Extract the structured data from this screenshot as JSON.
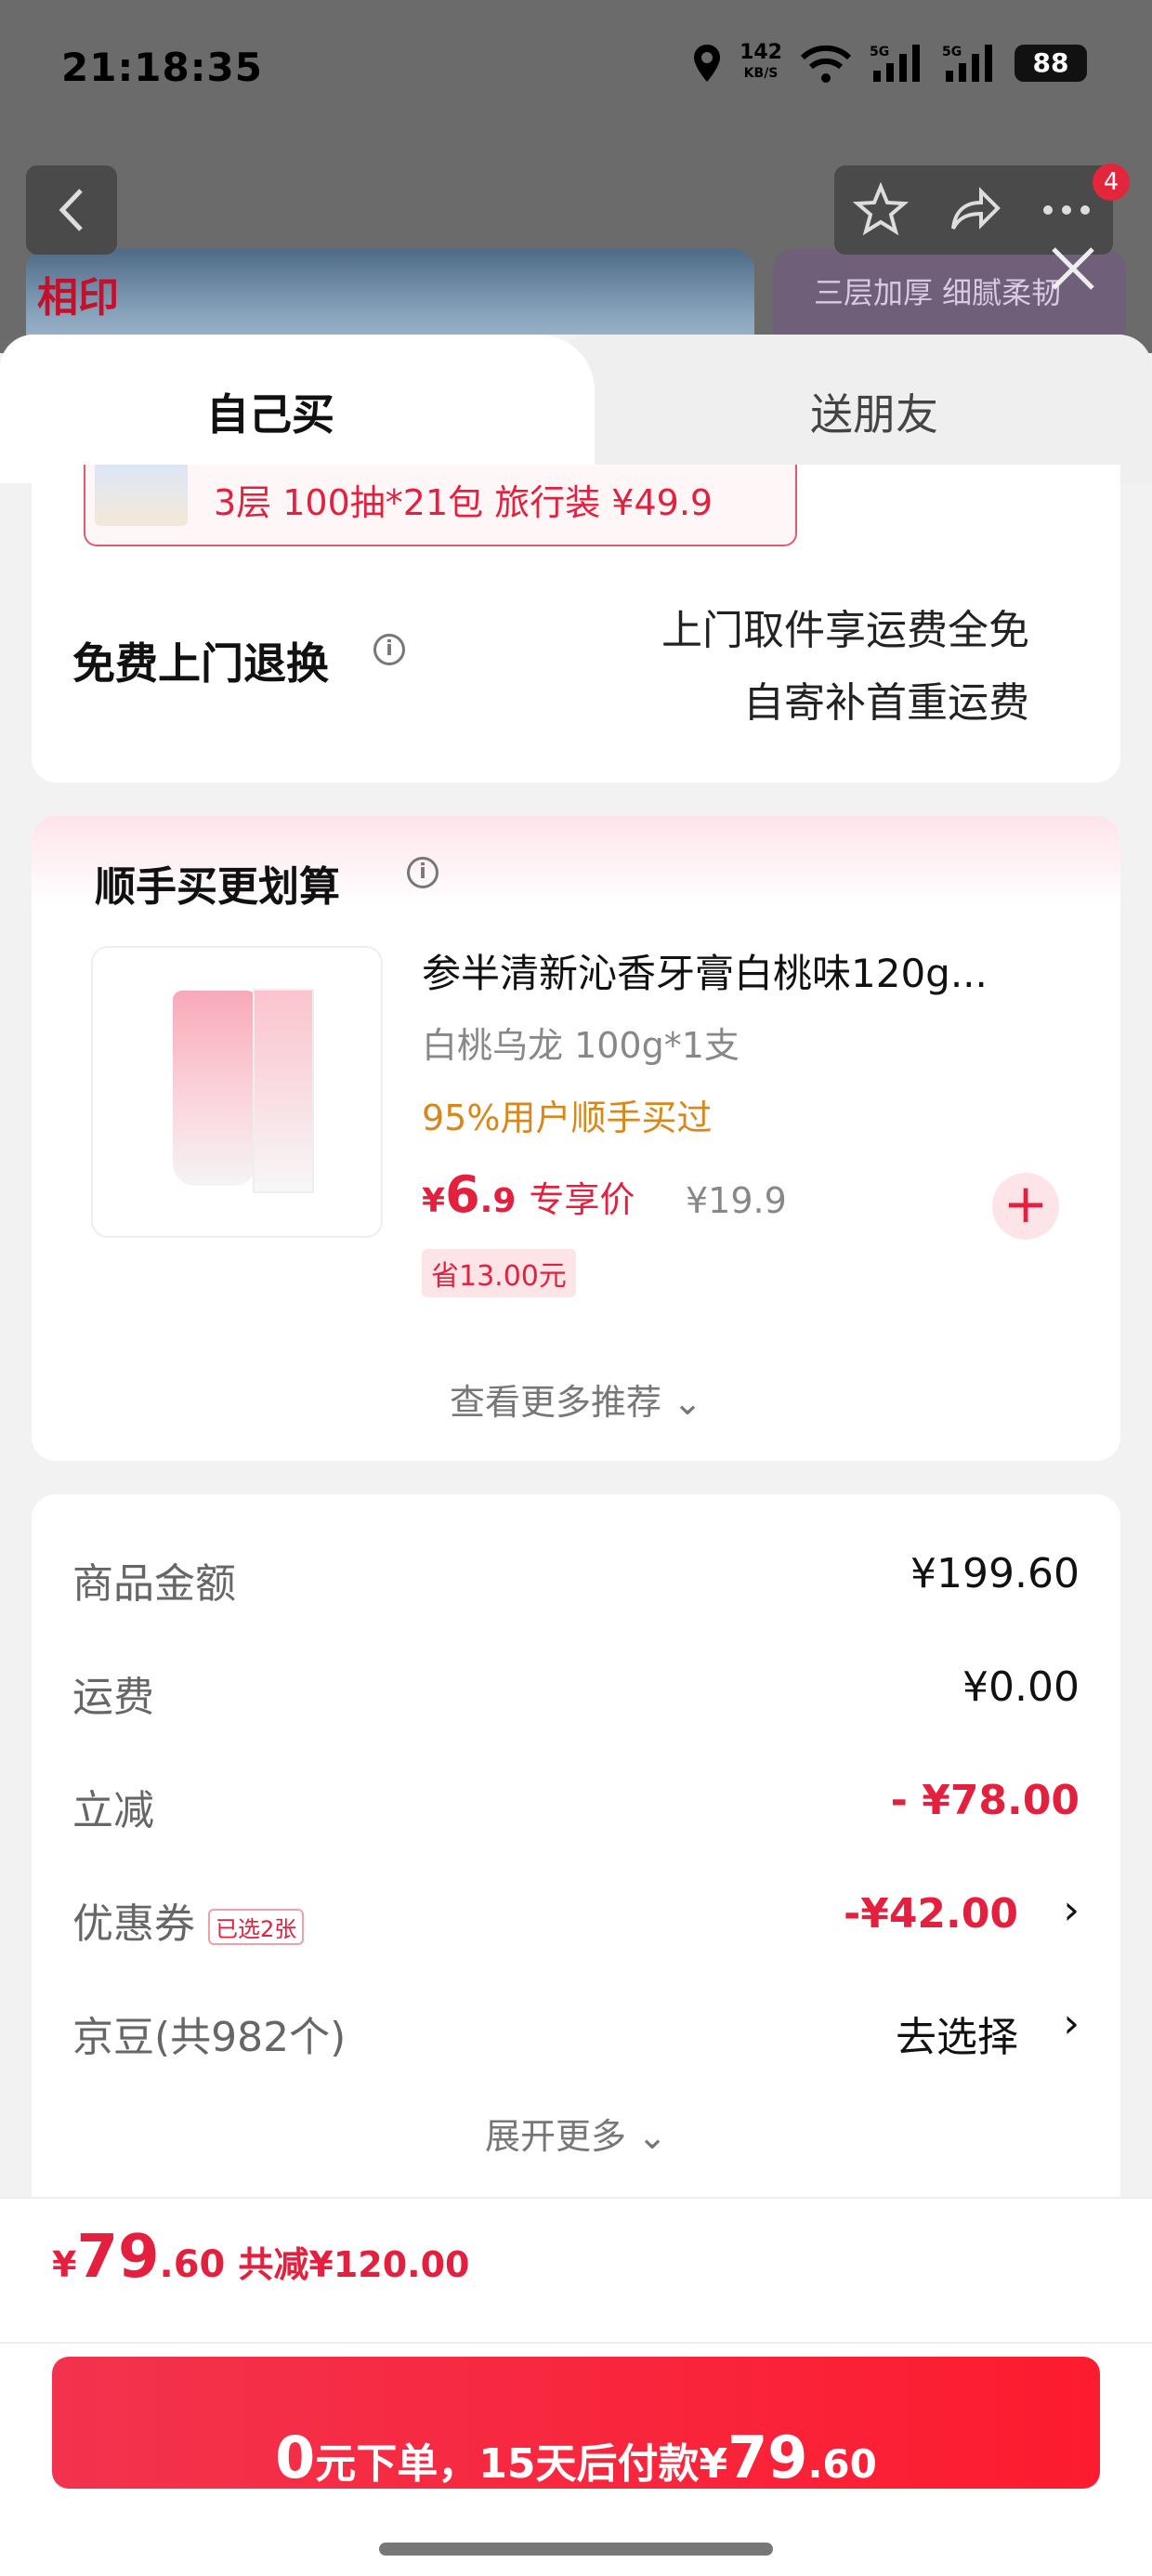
{
  "status_bar": {
    "time": "21:18:35",
    "net_speed": "142",
    "net_unit": "KB/S",
    "signal1": "5G",
    "signal2": "5G",
    "battery": "88"
  },
  "nav": {
    "badge_count": "4"
  },
  "background": {
    "brand_logo": "相印",
    "banner_text": "三层加厚 细腻柔韧"
  },
  "tabs": [
    {
      "label": "自己买"
    },
    {
      "label": "送朋友"
    }
  ],
  "promo": {
    "text": "3层 100抽*21包 旅行装  ¥49.9"
  },
  "return_service": {
    "title": "免费上门退换",
    "line1": "上门取件享运费全免",
    "line2": "自寄补首重运费"
  },
  "addon": {
    "title": "顺手买更划算",
    "product": {
      "name": "参半清新沁香牙膏白桃味120g...",
      "spec": "白桃乌龙 100g*1支",
      "buy_rate": "95%用户顺手买过",
      "price_symbol": "¥",
      "price_int": "6",
      "price_dec": ".9",
      "price_tag": "专享价",
      "original_price": "¥19.9",
      "save": "省13.00元",
      "add_label": "+"
    },
    "more_label": "查看更多推荐 ⌄"
  },
  "summary": {
    "rows": [
      {
        "label": "商品金额",
        "value": "¥199.60"
      },
      {
        "label": "运费",
        "value": "¥0.00"
      },
      {
        "label": "立减",
        "value": "- ¥78.00"
      },
      {
        "label": "优惠券",
        "tag": "已选2张",
        "value": "-¥42.00",
        "chevron": "›"
      },
      {
        "label": "京豆(共982个)",
        "value": "去选择",
        "chevron": "›"
      }
    ],
    "expand_label": "展开更多 ⌄"
  },
  "checkout": {
    "total_symbol": "¥",
    "total_int": "79",
    "total_dec": ".60",
    "total_cut": "共减¥120.00",
    "pay_big": "0",
    "pay_text": "元下单，15天后付款¥",
    "pay_int": "79",
    "pay_dec": ".60"
  },
  "colors": {
    "accent": "#e3213e",
    "button_gradient_start": "#f2334d",
    "button_gradient_end": "#fd1b2f",
    "highlight": "#d9871a"
  }
}
